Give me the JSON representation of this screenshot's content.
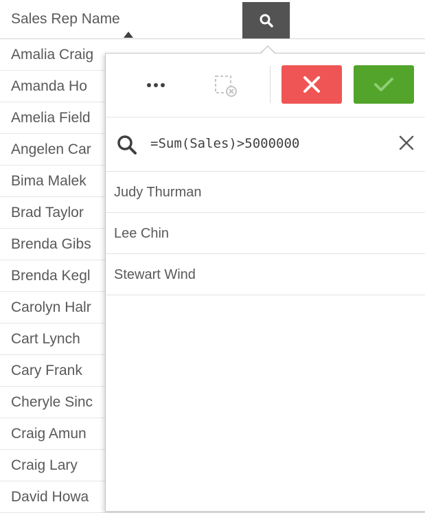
{
  "table": {
    "column_header": "Sales Rep Name",
    "rows": [
      "Amalia Craig",
      "Amanda Ho",
      "Amelia Field",
      "Angelen Car",
      "Bima Malek",
      "Brad Taylor",
      "Brenda Gibs",
      "Brenda Kegl",
      "Carolyn Halr",
      "Cart Lynch",
      "Cary Frank",
      "Cheryle Sinc",
      "Craig Amun",
      "Craig Lary",
      "David Howa"
    ]
  },
  "listbox": {
    "search_value": "=Sum(Sales)>5000000",
    "results": [
      "Judy Thurman",
      "Lee Chin",
      "Stewart Wind"
    ]
  },
  "colors": {
    "cancel": "#f05555",
    "confirm": "#52a42a",
    "header_search_button": "#535353"
  }
}
